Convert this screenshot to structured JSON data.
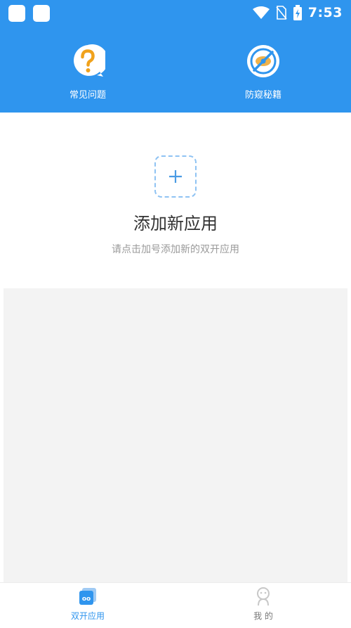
{
  "status_bar": {
    "time": "7:53"
  },
  "quick_actions": [
    {
      "label": "常见问题",
      "icon": "question-icon"
    },
    {
      "label": "防窥秘籍",
      "icon": "privacy-icon"
    }
  ],
  "add_app": {
    "title": "添加新应用",
    "hint": "请点击加号添加新的双开应用"
  },
  "bottom_nav": {
    "items": [
      {
        "label": "双开应用",
        "icon": "dual-apps-icon",
        "active": true
      },
      {
        "label": "我 的",
        "icon": "profile-icon",
        "active": false
      }
    ]
  },
  "colors": {
    "primary": "#2f95ee",
    "question_icon": "#f0a21c",
    "content_background": "#f3f3f3"
  }
}
